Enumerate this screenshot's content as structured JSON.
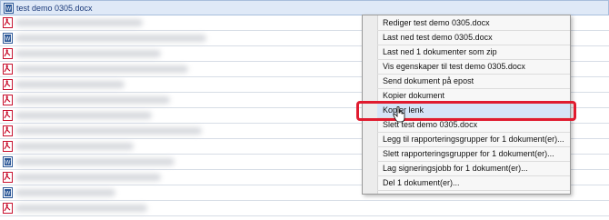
{
  "selected_file": {
    "name": "test demo 0305.docx",
    "icon": "word-doc-icon"
  },
  "rows": [
    {
      "icon": "pdf-icon"
    },
    {
      "icon": "word-doc-icon"
    },
    {
      "icon": "pdf-icon"
    },
    {
      "icon": "pdf-icon"
    },
    {
      "icon": "pdf-icon"
    },
    {
      "icon": "pdf-icon"
    },
    {
      "icon": "pdf-icon"
    },
    {
      "icon": "pdf-icon"
    },
    {
      "icon": "pdf-icon"
    },
    {
      "icon": "word-doc-icon"
    },
    {
      "icon": "pdf-icon"
    },
    {
      "icon": "word-doc-icon"
    },
    {
      "icon": "pdf-icon"
    }
  ],
  "context_menu": {
    "items": [
      "Rediger test demo 0305.docx",
      "Last ned test demo 0305.docx",
      "Last ned 1 dokumenter som zip",
      "Vis egenskaper til test demo 0305.docx",
      "Send dokument på epost",
      "Kopier dokument",
      "Kopier lenk",
      "Slett test demo 0305.docx",
      "Legg til rapporteringsgrupper for 1 dokument(er)...",
      "Slett rapporteringsgrupper for 1 dokument(er)...",
      "Lag signeringsjobb for 1 dokument(er)...",
      "Del 1 dokument(er)..."
    ],
    "hovered_item": "Kopier lenk"
  },
  "colors": {
    "highlight": "#e01b2f",
    "selected_row": "#dfe9f7",
    "pdf_red": "#c8102e",
    "word_blue": "#2b5797"
  }
}
